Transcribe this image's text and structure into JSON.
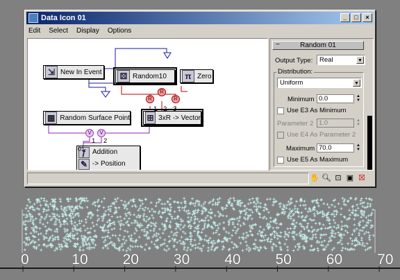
{
  "window": {
    "title": "Data Icon 01",
    "buttons": [
      "_",
      "□",
      "×"
    ]
  },
  "menu": [
    "Edit",
    "Select",
    "Display",
    "Options"
  ],
  "nodes": {
    "new_in_event": "New In Event",
    "random10": "Random10",
    "zero": "Zero",
    "random_surface_point": "Random Surface Point",
    "vector": "3xR -> Vector",
    "op_index": "01",
    "addition": "Addition",
    "position": "-> Position"
  },
  "badges": {
    "r1": "R",
    "r2": "R",
    "r3": "R",
    "num1": "1",
    "num2": "2",
    "num3": "3",
    "v1": "V",
    "v2": "V",
    "vnum1": "1",
    "vnum2": "2"
  },
  "rollout": {
    "header": "Random 01",
    "collapse": "−",
    "output_type_label": "Output Type:",
    "output_type_value": "Real",
    "distribution_label": "Distribution:",
    "distribution_value": "Uniform",
    "minimum_label": "Minimum",
    "minimum_value": "0.0",
    "use_e3_label": "Use E3 As Minimum",
    "parameter2_label": "Parameter 2",
    "parameter2_value": "1.0",
    "use_e4_label": "Use E4 As Parameter 2",
    "maximum_label": "Maximum",
    "maximum_value": "70.0",
    "use_e5_label": "Use E5 As Maximum"
  },
  "toolbar_icons": [
    "hand-icon",
    "zoom-icon",
    "zoom-region-icon",
    "frame-icon",
    "delete-icon"
  ],
  "ruler": {
    "ticks": [
      "0",
      "10",
      "20",
      "30",
      "40",
      "50",
      "60",
      "70"
    ]
  },
  "colors": {
    "title_gradient_start": "#0a246a",
    "particle": "#c8f4f0",
    "wire_blue": "#1a1aa0",
    "wire_red": "#c00000",
    "wire_purple": "#9020b0"
  }
}
